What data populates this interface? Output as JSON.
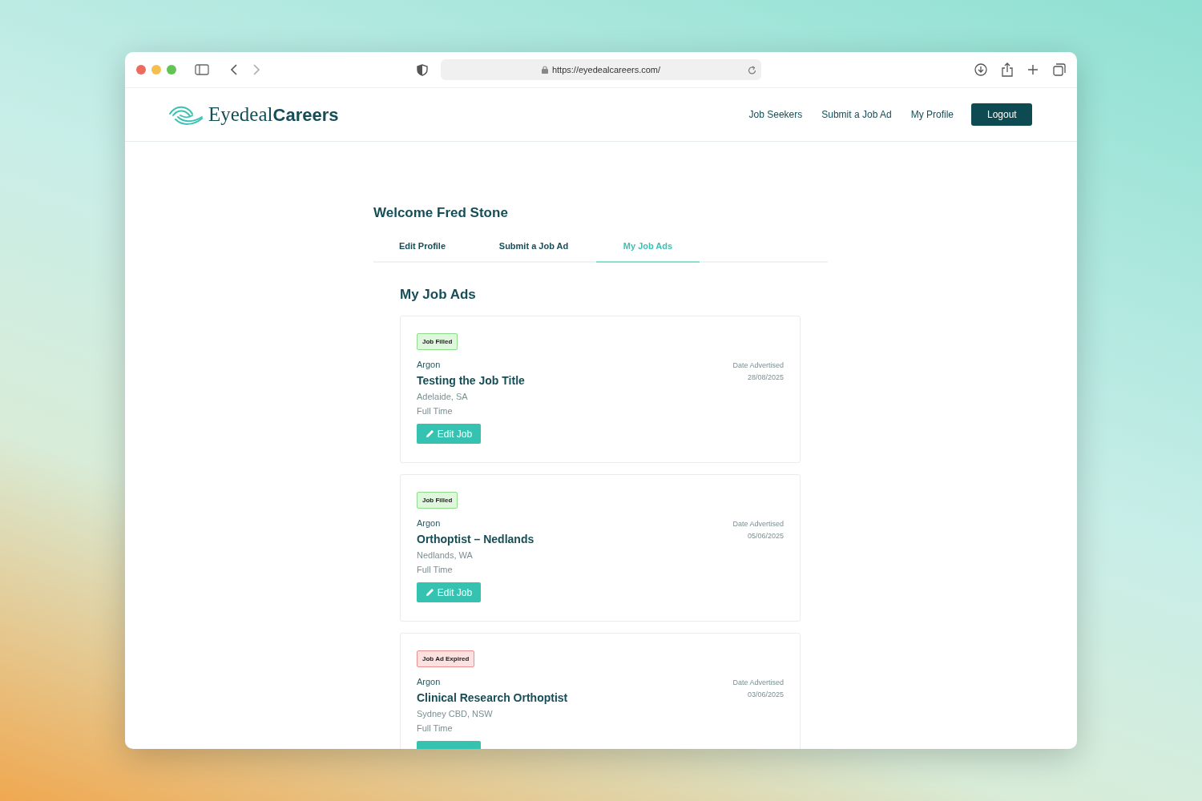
{
  "browser": {
    "url": "https://eyedealcareers.com/"
  },
  "site": {
    "logo": "Eyedeal**Careers**",
    "nav": [
      "Job Seekers",
      "Submit a Job Ad",
      "My Profile"
    ],
    "logout": "Logout"
  },
  "welcome": "Welcome Fred Stone",
  "tabs": [
    {
      "label": "Edit Profile",
      "selected": false
    },
    {
      "label": "Submit a Job Ad",
      "selected": false
    },
    {
      "label": "My Job Ads",
      "selected": true
    }
  ],
  "section_title": "My Job Ads",
  "jobs": [
    {
      "kind": "filled",
      "status": "Job Filled",
      "company": "Argon",
      "title": "Testing the Job Title",
      "location": "Adelaide, SA",
      "type": "Full Time",
      "date_label": "Date Advertised",
      "date": "28/08/2025",
      "edit_button": "Edit Job"
    },
    {
      "kind": "filled",
      "status": "Job Filled",
      "company": "Argon",
      "title": "Orthoptist – Nedlands",
      "location": "Nedlands, WA",
      "type": "Full Time",
      "date_label": "Date Advertised",
      "date": "05/06/2025",
      "edit_button": "Edit Job"
    },
    {
      "kind": "expired",
      "status": "Job Ad Expired",
      "company": "Argon",
      "title": "Clinical Research Orthoptist",
      "location": "Sydney CBD, NSW",
      "type": "Full Time",
      "date_label": "Date Advertised",
      "date": "03/06/2025"
    }
  ]
}
